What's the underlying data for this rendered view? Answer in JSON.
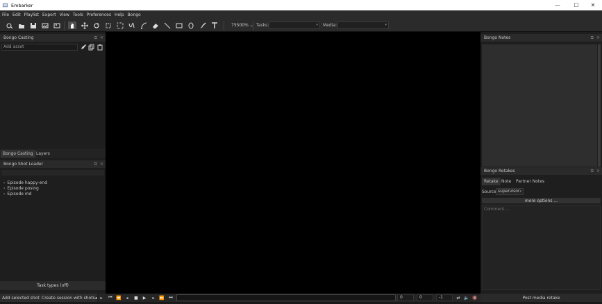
{
  "window": {
    "title": "Embarker",
    "minimize": "—",
    "maximize": "☐",
    "close": "✕"
  },
  "menu": [
    "File",
    "Edit",
    "Playlist",
    "Export",
    "View",
    "Tools",
    "Preferences",
    "Help",
    "Bongo"
  ],
  "toolbar": {
    "zoom": "75500% ⌄",
    "tasks_label": "Tasks:",
    "media_label": "Media:",
    "tasks_value": "",
    "media_value": ""
  },
  "left_top_panel": {
    "title": "Bongo Casting",
    "add_asset_placeholder": "Add asset"
  },
  "left_tabs": [
    "Bongo Casting",
    "Layers"
  ],
  "shot_loader": {
    "title": "Bongo Shot Loader",
    "episodes": [
      "Episode  happy-end",
      "Episode  posing",
      "Episode  md"
    ],
    "task_types": "Task types (off)"
  },
  "notes_panel": {
    "title": "Bongo Notes"
  },
  "retakes_panel": {
    "title": "Bongo Retakes",
    "tabs": [
      "Retake",
      "Note",
      "Partner Notes"
    ],
    "source_label": "Source",
    "source_value": "supervisor",
    "more_options": "more options ...",
    "comment_placeholder": "Comment ...",
    "post_button": "Post media retake"
  },
  "bottom": {
    "add_selected_shots": "Add selected shots",
    "create_session": "Create session with shots",
    "field_a": "0",
    "field_b": "0",
    "field_c": "-1"
  }
}
